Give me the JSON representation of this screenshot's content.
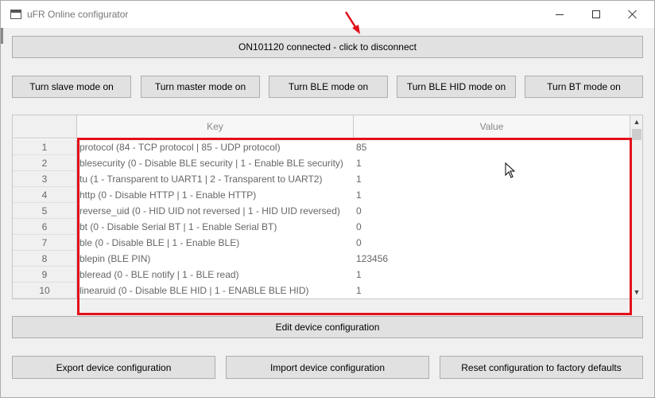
{
  "window": {
    "title": "uFR Online configurator"
  },
  "connection": {
    "label": "ON101120 connected - click to disconnect"
  },
  "modes": [
    {
      "label": "Turn slave mode on"
    },
    {
      "label": "Turn master mode on"
    },
    {
      "label": "Turn BLE mode on"
    },
    {
      "label": "Turn BLE HID mode on"
    },
    {
      "label": "Turn BT mode on"
    }
  ],
  "table": {
    "headers": {
      "key": "Key",
      "value": "Value"
    },
    "rows": [
      {
        "num": "1",
        "key": "protocol (84 - TCP protocol | 85 - UDP protocol)",
        "value": "85"
      },
      {
        "num": "2",
        "key": "blesecurity (0 - Disable BLE security | 1 - Enable BLE security)",
        "value": "1"
      },
      {
        "num": "3",
        "key": "tu (1 - Transparent to UART1 | 2 - Transparent to UART2)",
        "value": "1"
      },
      {
        "num": "4",
        "key": "http (0 - Disable HTTP | 1 - Enable HTTP)",
        "value": "1"
      },
      {
        "num": "5",
        "key": "reverse_uid (0 - HID UID not reversed | 1 - HID UID reversed)",
        "value": "0"
      },
      {
        "num": "6",
        "key": "bt (0 - Disable Serial BT | 1 - Enable Serial BT)",
        "value": "0"
      },
      {
        "num": "7",
        "key": "ble (0 - Disable BLE | 1 - Enable BLE)",
        "value": "0"
      },
      {
        "num": "8",
        "key": "blepin (BLE PIN)",
        "value": "123456"
      },
      {
        "num": "9",
        "key": "bleread (0 - BLE notify | 1 - BLE read)",
        "value": "1"
      },
      {
        "num": "10",
        "key": "linearuid (0 - Disable BLE HID | 1 - ENABLE BLE HID)",
        "value": "1"
      }
    ]
  },
  "actions": {
    "edit": "Edit device configuration",
    "export": "Export device configuration",
    "import": "Import device configuration",
    "reset": "Reset configuration to factory defaults"
  },
  "colors": {
    "highlight": "#e3101a",
    "button_bg": "#e1e1e1"
  },
  "icons": {
    "app": "window-icon",
    "minimize": "minimize-icon",
    "maximize": "maximize-icon",
    "close": "close-icon",
    "scroll_up": "chevron-up-icon",
    "scroll_down": "chevron-down-icon",
    "pointer": "mouse-pointer-icon",
    "annotation": "red-arrow-icon"
  }
}
